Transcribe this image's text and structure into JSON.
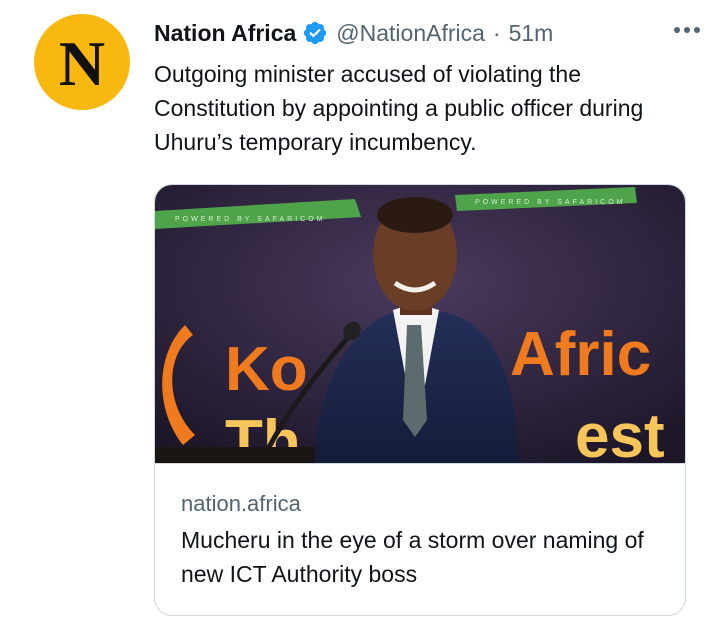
{
  "author": {
    "avatar_letter": "N",
    "name": "Nation Africa",
    "handle": "@NationAfrica",
    "separator": "·",
    "time_ago": "51m",
    "verified_icon": "verified-badge-icon",
    "avatar_color": "#f9b80f",
    "verified_color": "#1d9bf0"
  },
  "tweet": {
    "text": "Outgoing minister accused of violating the Constitution by appointing a public officer during Uhuru’s temporary incumbency."
  },
  "card": {
    "domain": "nation.africa",
    "title": "Mucheru in the eye of a storm over naming of new ICT Authority boss",
    "banner_text_left": "Ko",
    "banner_text_right": "Afric",
    "banner_text_bottom_left": "Th",
    "banner_text_bottom_right": "est",
    "banner_strip_text": "POWERED BY SAFARICOM"
  },
  "more_icon": "more-horizontal-icon"
}
